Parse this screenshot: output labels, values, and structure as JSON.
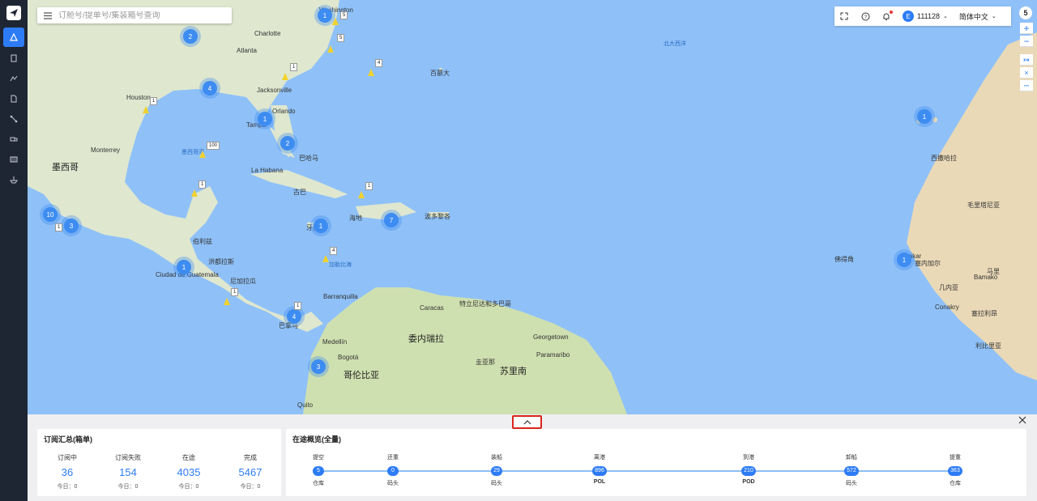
{
  "search": {
    "placeholder": "订舱号/提单号/集装箱号查询"
  },
  "toolbar": {
    "username": "111128",
    "avatar_initial": "E",
    "language": "简体中文"
  },
  "map": {
    "zoom_level": "5",
    "labels": {
      "mexico": "墨西哥",
      "venezuela": "委内瑞拉",
      "colombia": "哥伦比亚",
      "atlantic": "北大西洋",
      "washington": "Washington",
      "charlotte": "Charlotte",
      "atlanta": "Atlanta",
      "jacksonville": "Jacksonville",
      "orlando": "Orlando",
      "tampa": "Tampa",
      "houston": "Houston",
      "monterrey": "Monterrey",
      "la_habana": "La Habana",
      "caracas": "Caracas",
      "bogota": "Bogotá",
      "medellin": "Medellín",
      "quito": "Quito",
      "barranquilla": "Barranquilla",
      "guatemala": "Ciudad de Guatemala",
      "georgetown": "Georgetown",
      "paramaribo": "Paramaribo",
      "dakar": "Dakar",
      "conakry": "Conakry",
      "bamako": "Bamako",
      "west_sahara": "西撒哈拉",
      "mauritania": "毛里塔尼亚",
      "senegal": "塞内加尔",
      "mali": "马里",
      "guinea": "几内亚",
      "suriname": "苏里南",
      "guyana": "圭亚那",
      "bermuda": "百慕大",
      "bahamas": "巴哈马",
      "cuba": "古巴",
      "haiti": "海地",
      "jamaica": "牙买加",
      "puerto_rico": "波多黎各",
      "honduras": "洪都拉斯",
      "nicaragua": "尼加拉瓜",
      "panama": "巴拿马",
      "trinidad": "特立尼达和多巴哥",
      "sierra_leone": "塞拉利昂",
      "liberia": "利比里亚",
      "mexico_gulf": "墨西哥湾",
      "caribbean": "加勒比海",
      "cape_verde": "佛得角",
      "belize": "伯利兹"
    },
    "clusters": [
      "1",
      "2",
      "4",
      "1",
      "2",
      "10",
      "3",
      "1",
      "4",
      "3",
      "1",
      "7",
      "1",
      "1"
    ],
    "vessel_tags": [
      "5",
      "5",
      "1",
      "4",
      "1",
      "100",
      "1",
      "1",
      "1",
      "4",
      "1",
      "1"
    ]
  },
  "panel": {
    "collapse_icon": "chevron-up-icon",
    "close_icon": "close-icon",
    "summary": {
      "title": "订阅汇总(箱单)",
      "stats": [
        {
          "label": "订阅中",
          "value": "36",
          "today": "今日：0"
        },
        {
          "label": "订阅失败",
          "value": "154",
          "today": "今日：0"
        },
        {
          "label": "在途",
          "value": "4035",
          "today": "今日：0"
        },
        {
          "label": "完成",
          "value": "5467",
          "today": "今日：0"
        }
      ]
    },
    "transit": {
      "title": "在途概览(全量)",
      "steps": [
        {
          "top": "提空",
          "count": "5",
          "bottom": "仓库"
        },
        {
          "top": "还重",
          "count": "0",
          "bottom": "码头"
        },
        {
          "top": "装船",
          "count": "29",
          "bottom": "码头"
        },
        {
          "top": "离港",
          "count": "896",
          "bottom": "POL"
        },
        {
          "top": "到港",
          "count": "210",
          "bottom": "POD"
        },
        {
          "top": "卸船",
          "count": "572",
          "bottom": "码头"
        },
        {
          "top": "提重",
          "count": "363",
          "bottom": "仓库"
        }
      ]
    }
  }
}
